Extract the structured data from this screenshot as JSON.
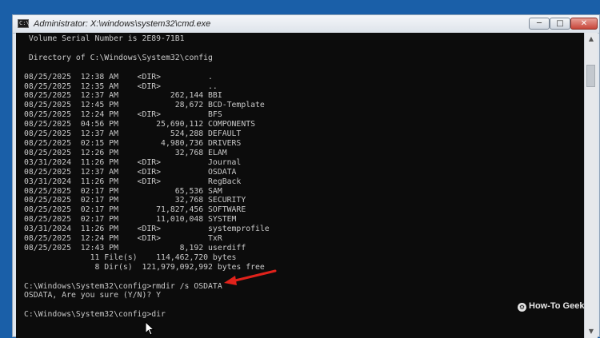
{
  "window": {
    "title": "Administrator: X:\\windows\\system32\\cmd.exe",
    "app_icon": "C:\\",
    "controls": {
      "minimize": "─",
      "maximize": "□",
      "close": "✕"
    }
  },
  "console": {
    "lines": [
      " Volume Serial Number is 2E89-71B1",
      "",
      " Directory of C:\\Windows\\System32\\config",
      "",
      "08/25/2025  12:38 AM    <DIR>          .",
      "08/25/2025  12:35 AM    <DIR>          ..",
      "08/25/2025  12:37 AM           262,144 BBI",
      "08/25/2025  12:45 PM            28,672 BCD-Template",
      "08/25/2025  12:24 PM    <DIR>          BFS",
      "08/25/2025  04:56 PM        25,690,112 COMPONENTS",
      "08/25/2025  12:37 AM           524,288 DEFAULT",
      "08/25/2025  02:15 PM         4,980,736 DRIVERS",
      "08/25/2025  12:26 PM            32,768 ELAM",
      "03/31/2024  11:26 PM    <DIR>          Journal",
      "08/25/2025  12:37 AM    <DIR>          OSDATA",
      "03/31/2024  11:26 PM    <DIR>          RegBack",
      "08/25/2025  02:17 PM            65,536 SAM",
      "08/25/2025  02:17 PM            32,768 SECURITY",
      "08/25/2025  02:17 PM        71,827,456 SOFTWARE",
      "08/25/2025  02:17 PM        11,010,048 SYSTEM",
      "03/31/2024  11:26 PM    <DIR>          systemprofile",
      "08/25/2025  12:24 PM    <DIR>          TxR",
      "08/25/2025  12:43 PM             8,192 userdiff",
      "              11 File(s)    114,462,720 bytes",
      "               8 Dir(s)  121,979,092,992 bytes free",
      "",
      "C:\\Windows\\System32\\config>rmdir /s OSDATA",
      "OSDATA, Are you sure (Y/N)? Y",
      "",
      "C:\\Windows\\System32\\config>dir"
    ]
  },
  "annotation": {
    "arrow_color": "#e0221b"
  },
  "watermark": {
    "logo": "⚙",
    "text": "How-To Geek"
  },
  "icons": {
    "app": "cmd-app-icon",
    "cursor": "mouse-pointer-icon",
    "arrow": "red-arrow-annotation-icon"
  }
}
